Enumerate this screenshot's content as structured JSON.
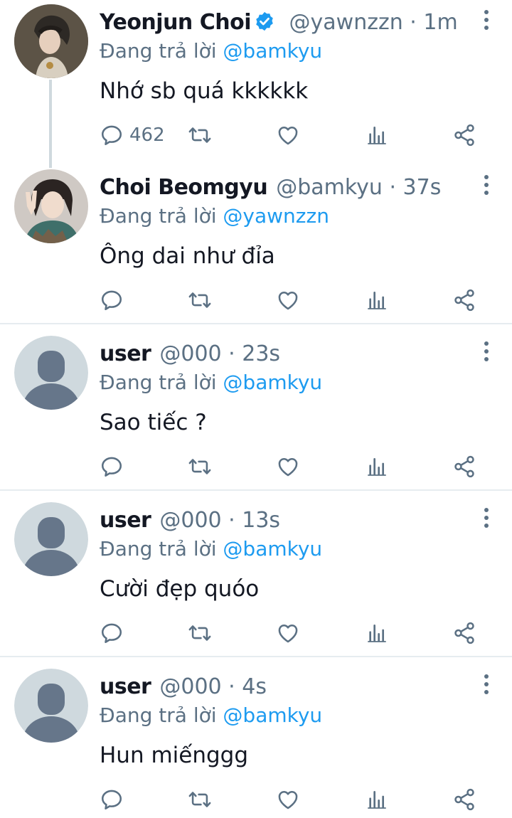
{
  "tweets": [
    {
      "name": "Yeonjun Choi",
      "verified": true,
      "handle": "@yawnzzn",
      "time": "1m",
      "reply_prefix": "Đang trả lời",
      "reply_to": "@bamkyu",
      "text": "Nhớ sb quá kkkkkk",
      "reply_count": "462",
      "avatar": "yeonjun-photo"
    },
    {
      "name": "Choi Beomgyu",
      "verified": false,
      "handle": "@bamkyu",
      "time": "37s",
      "reply_prefix": "Đang trả lời",
      "reply_to": "@yawnzzn",
      "text": "Ông dai như đỉa",
      "reply_count": "",
      "avatar": "beomgyu-photo"
    },
    {
      "name": "user",
      "verified": false,
      "handle": "@000",
      "time": "23s",
      "reply_prefix": "Đang trả lời",
      "reply_to": "@bamkyu",
      "text": "Sao tiếc ?",
      "reply_count": "",
      "avatar": "default-avatar"
    },
    {
      "name": "user",
      "verified": false,
      "handle": "@000",
      "time": "13s",
      "reply_prefix": "Đang trả lời",
      "reply_to": "@bamkyu",
      "text": "Cười đẹp quóo",
      "reply_count": "",
      "avatar": "default-avatar"
    },
    {
      "name": "user",
      "verified": false,
      "handle": "@000",
      "time": "4s",
      "reply_prefix": "Đang trả lời",
      "reply_to": "@bamkyu",
      "text": "Hun miếnggg",
      "reply_count": "",
      "avatar": "default-avatar"
    }
  ],
  "separator": "·",
  "colors": {
    "accent": "#1d9bf0",
    "muted": "#5b7083",
    "text": "#141823",
    "divider": "#e6ecf0"
  }
}
